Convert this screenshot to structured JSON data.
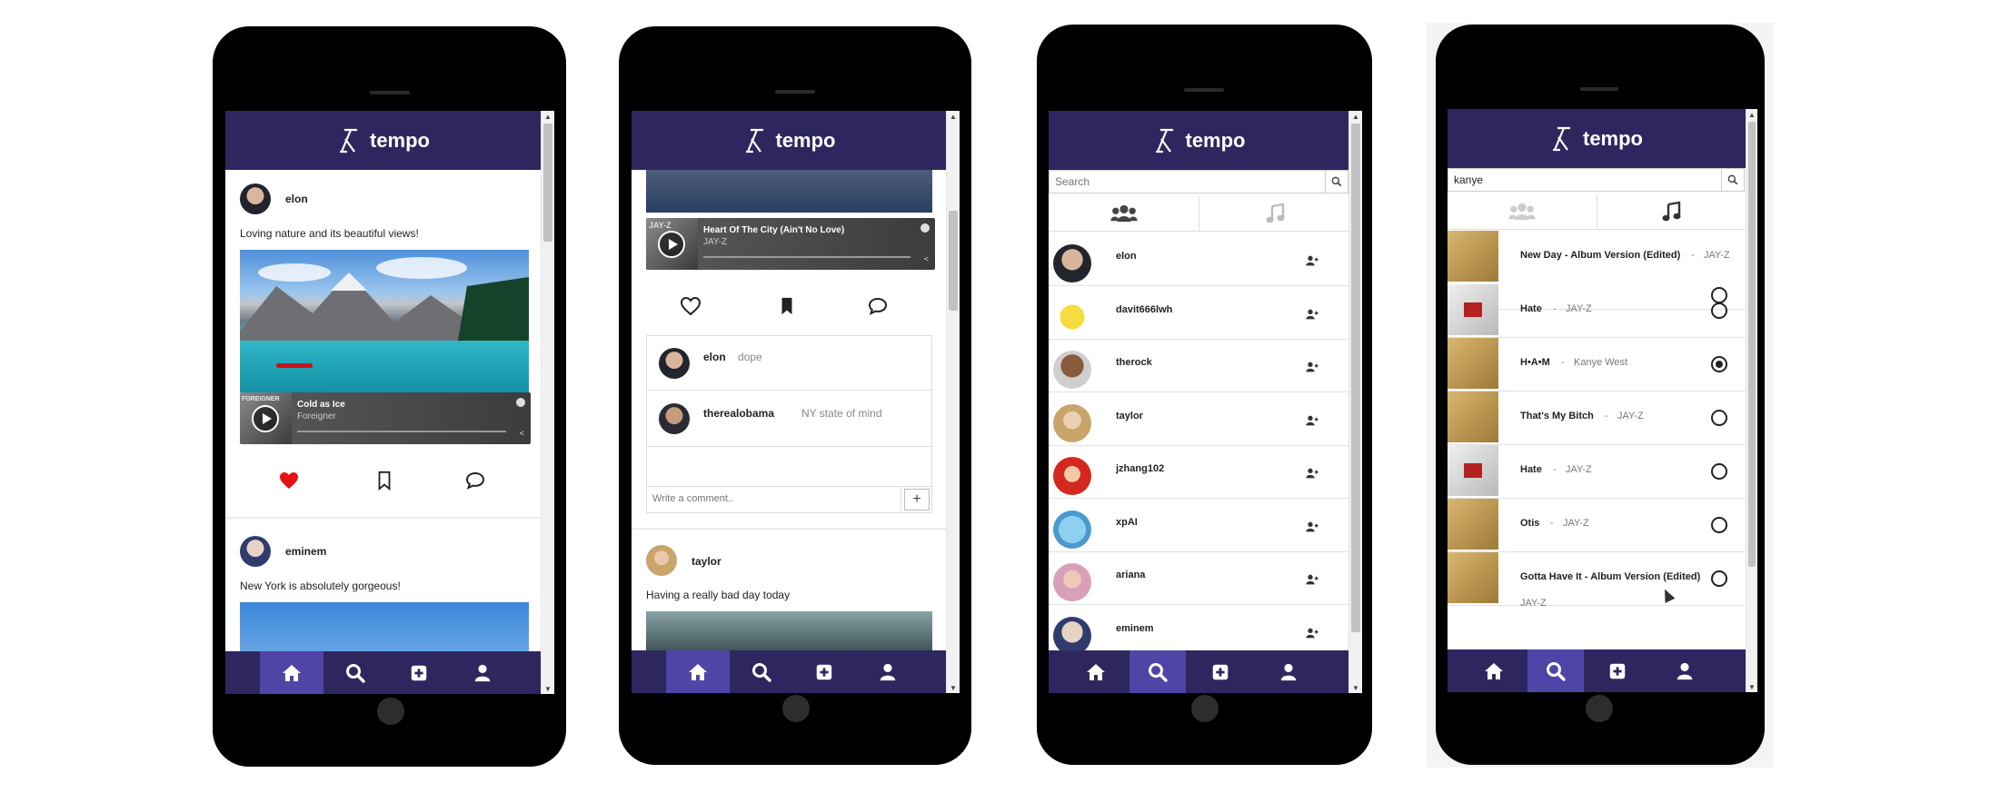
{
  "brand": "tempo",
  "colors": {
    "header": "#2e275f",
    "nav_active": "#4f45a6",
    "like_red": "#e51212"
  },
  "phone1": {
    "posts": [
      {
        "user": "elon",
        "caption": "Loving nature and its beautiful views!",
        "track": {
          "title": "Cold as Ice",
          "artist": "Foreigner",
          "art_text": "FOREIGNER"
        }
      },
      {
        "user": "eminem",
        "caption": "New York is absolutely gorgeous!"
      }
    ],
    "nav_active": "home"
  },
  "phone2": {
    "track": {
      "title": "Heart Of The City (Ain't No Love)",
      "artist": "JAY-Z",
      "art_text": "JAY-Z"
    },
    "comments": [
      {
        "user": "elon",
        "text": "dope"
      },
      {
        "user": "therealobama",
        "text": "NY state of mind"
      }
    ],
    "comment_placeholder": "Write a comment..",
    "next_post": {
      "user": "taylor",
      "caption": "Having a really bad day today"
    },
    "nav_active": "home"
  },
  "phone3": {
    "search_placeholder": "Search",
    "users": [
      "elon",
      "davit666lwh",
      "therock",
      "taylor",
      "jzhang102",
      "xpAI",
      "ariana",
      "eminem"
    ],
    "nav_active": "search"
  },
  "phone4": {
    "search_value": "kanye",
    "songs": [
      {
        "title": "New Day - Album Version (Edited)",
        "artist": "JAY-Z",
        "selected": false
      },
      {
        "title": "Hate",
        "artist": "JAY-Z",
        "selected": false
      },
      {
        "title": "H•A•M",
        "artist": "Kanye West",
        "selected": true
      },
      {
        "title": "That's My Bitch",
        "artist": "JAY-Z",
        "selected": false
      },
      {
        "title": "Hate",
        "artist": "JAY-Z",
        "selected": false
      },
      {
        "title": "Otis",
        "artist": "JAY-Z",
        "selected": false
      },
      {
        "title": "Gotta Have It - Album Version (Edited)",
        "artist": "JAY-Z",
        "selected": false
      }
    ],
    "separator": "-",
    "nav_active": "search"
  },
  "nav_icons": [
    "home-icon",
    "search-icon",
    "add-post-icon",
    "profile-icon"
  ]
}
